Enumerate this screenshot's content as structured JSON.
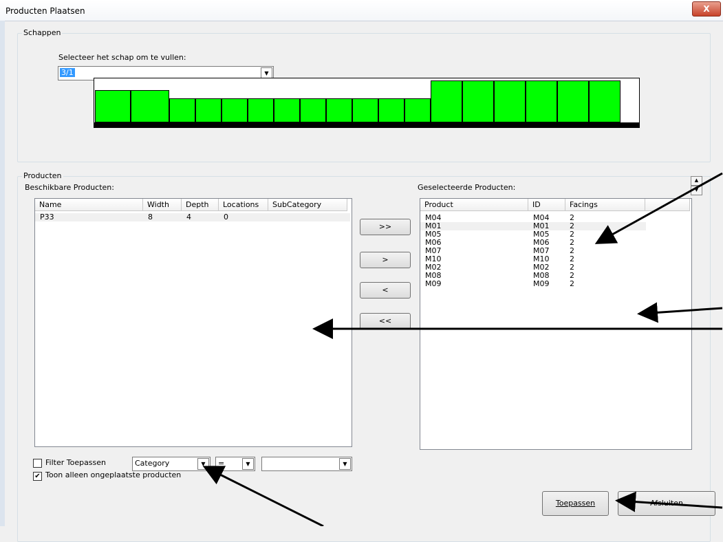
{
  "window": {
    "title": "Producten Plaatsen",
    "close_glyph": "X"
  },
  "schappen": {
    "group_label": "Schappen",
    "select_label": "Selecteer het schap om te vullen:",
    "selected_shelf": "3/1"
  },
  "shelf_slots": [
    {
      "level": 0.74
    },
    {
      "level": 0.74
    },
    {
      "level": 0.55
    },
    {
      "level": 0.55
    },
    {
      "level": 0.55
    },
    {
      "level": 0.55
    },
    {
      "level": 0.55
    },
    {
      "level": 0.55
    },
    {
      "level": 0.55
    },
    {
      "level": 0.55
    },
    {
      "level": 0.55
    },
    {
      "level": 0.55
    },
    {
      "level": 0.95
    },
    {
      "level": 0.95
    },
    {
      "level": 0.95
    },
    {
      "level": 0.95
    },
    {
      "level": 0.95
    },
    {
      "level": 0.95
    }
  ],
  "producten": {
    "group_label": "Producten",
    "available_label": "Beschikbare Producten:",
    "selected_label": "Geselecteerde Producten:",
    "available_columns": [
      "Name",
      "Width",
      "Depth",
      "Locations",
      "SubCategory"
    ],
    "available_rows": [
      {
        "name": "P33",
        "width": "8",
        "depth": "4",
        "locations": "0",
        "subcategory": ""
      }
    ],
    "selected_columns": [
      "Product",
      "ID",
      "Facings"
    ],
    "selected_rows": [
      {
        "product": "M04",
        "id": "M04",
        "facings": "2"
      },
      {
        "product": "M01",
        "id": "M01",
        "facings": "2"
      },
      {
        "product": "M05",
        "id": "M05",
        "facings": "2"
      },
      {
        "product": "M06",
        "id": "M06",
        "facings": "2"
      },
      {
        "product": "M07",
        "id": "M07",
        "facings": "2"
      },
      {
        "product": "M10",
        "id": "M10",
        "facings": "2"
      },
      {
        "product": "M02",
        "id": "M02",
        "facings": "2"
      },
      {
        "product": "M08",
        "id": "M08",
        "facings": "2"
      },
      {
        "product": "M09",
        "id": "M09",
        "facings": "2"
      }
    ]
  },
  "transfer_buttons": {
    "add_all": ">>",
    "add_one": ">",
    "remove_one": "<",
    "remove_all": "<<"
  },
  "filter": {
    "apply_label": "Filter Toepassen",
    "apply_checked": false,
    "field_value": "Category",
    "operator_value": "=",
    "value_value": "",
    "only_unplaced_label": "Toon alleen ongeplaatste producten",
    "only_unplaced_checked": true
  },
  "footer": {
    "apply_button": "Toepassen",
    "close_button": "Afsluiten"
  },
  "colors": {
    "slot_fill": "#00ff00",
    "selection": "#3399ff"
  }
}
